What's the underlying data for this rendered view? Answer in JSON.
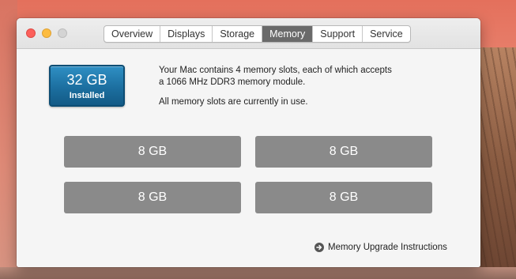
{
  "window": {
    "tabs": [
      {
        "label": "Overview"
      },
      {
        "label": "Displays"
      },
      {
        "label": "Storage"
      },
      {
        "label": "Memory"
      },
      {
        "label": "Support"
      },
      {
        "label": "Service"
      }
    ],
    "active_tab": "Memory"
  },
  "memory": {
    "installed_size": "32 GB",
    "installed_label": "Installed",
    "description_line1": "Your Mac contains 4 memory slots, each of which accepts",
    "description_line2": "a 1066 MHz DDR3 memory module.",
    "status_text": "All memory slots are currently in use.",
    "slots": [
      {
        "size": "8 GB"
      },
      {
        "size": "8 GB"
      },
      {
        "size": "8 GB"
      },
      {
        "size": "8 GB"
      }
    ],
    "upgrade_link_label": "Memory Upgrade Instructions",
    "badge_color": "#1c6fa0",
    "slot_color": "#8a8a8a"
  },
  "icons": {
    "upgrade_link_icon": "arrow-right-circle-icon"
  }
}
